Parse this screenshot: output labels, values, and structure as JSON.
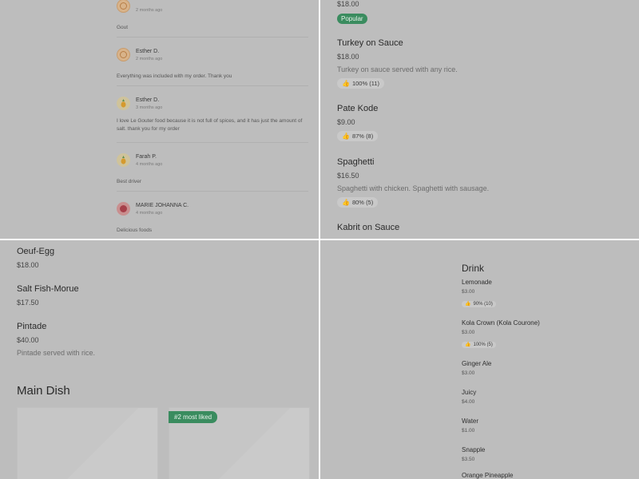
{
  "reviews": [
    {
      "name": "",
      "date": "2 months ago",
      "text": "Gout",
      "avatar": "smile-avatar-icon"
    },
    {
      "name": "Esther D.",
      "date": "2 months ago",
      "text": "Everything was included with my order. Thank you",
      "avatar": "smile-avatar-icon"
    },
    {
      "name": "Esther D.",
      "date": "3 months ago",
      "text": "I love Le Gouter food because it is not full of spices, and it has just the amount of salt. thank you for my order",
      "avatar": "pineapple-avatar-icon"
    },
    {
      "name": "Farah P.",
      "date": "4 months ago",
      "text": "Best driver",
      "avatar": "pineapple-avatar-icon"
    },
    {
      "name": "MARIE JOHANNA C.",
      "date": "4 months ago",
      "text": "Delicious foods",
      "avatar": "red-circle-avatar-icon"
    }
  ],
  "menu_right": {
    "top_item": {
      "price": "$18.00",
      "badge": "Popular"
    },
    "items": [
      {
        "title": "Turkey on Sauce",
        "price": "$18.00",
        "desc": "Turkey on sauce served with any rice.",
        "rating": "100% (11)"
      },
      {
        "title": "Pate Kode",
        "price": "$9.00",
        "desc": "",
        "rating": "87% (8)"
      },
      {
        "title": "Spaghetti",
        "price": "$16.50",
        "desc": "Spaghetti with chicken. Spaghetti with sausage.",
        "rating": "80% (5)"
      },
      {
        "title": "Kabrit on Sauce",
        "price": "",
        "desc": "",
        "rating": ""
      }
    ]
  },
  "menu_left": {
    "items": [
      {
        "title": "Oeuf-Egg",
        "price": "$18.00",
        "desc": ""
      },
      {
        "title": "Salt Fish-Morue",
        "price": "$17.50",
        "desc": ""
      },
      {
        "title": "Pintade",
        "price": "$40.00",
        "desc": "Pintade served with rice."
      }
    ],
    "section_title": "Main Dish",
    "liked_badge": "#2 most liked"
  },
  "drinks": {
    "title": "Drink",
    "items": [
      {
        "name": "Lemonade",
        "price": "$3.00",
        "rating": "90% (10)"
      },
      {
        "name": "Kola Crown (Kola Courone)",
        "price": "$3.00",
        "rating": "100% (5)"
      },
      {
        "name": "Ginger Ale",
        "price": "$3.00",
        "rating": ""
      },
      {
        "name": "Juicy",
        "price": "$4.00",
        "rating": ""
      },
      {
        "name": "Water",
        "price": "$1.00",
        "rating": ""
      },
      {
        "name": "Snapple",
        "price": "$3.50",
        "rating": ""
      },
      {
        "name": "Orange Pineapple",
        "price": "",
        "rating": ""
      }
    ]
  },
  "icons": {
    "thumb": "👍"
  },
  "colors": {
    "accent_green": "#3a8c5f",
    "overlay_gray": "#bdbdbd"
  }
}
